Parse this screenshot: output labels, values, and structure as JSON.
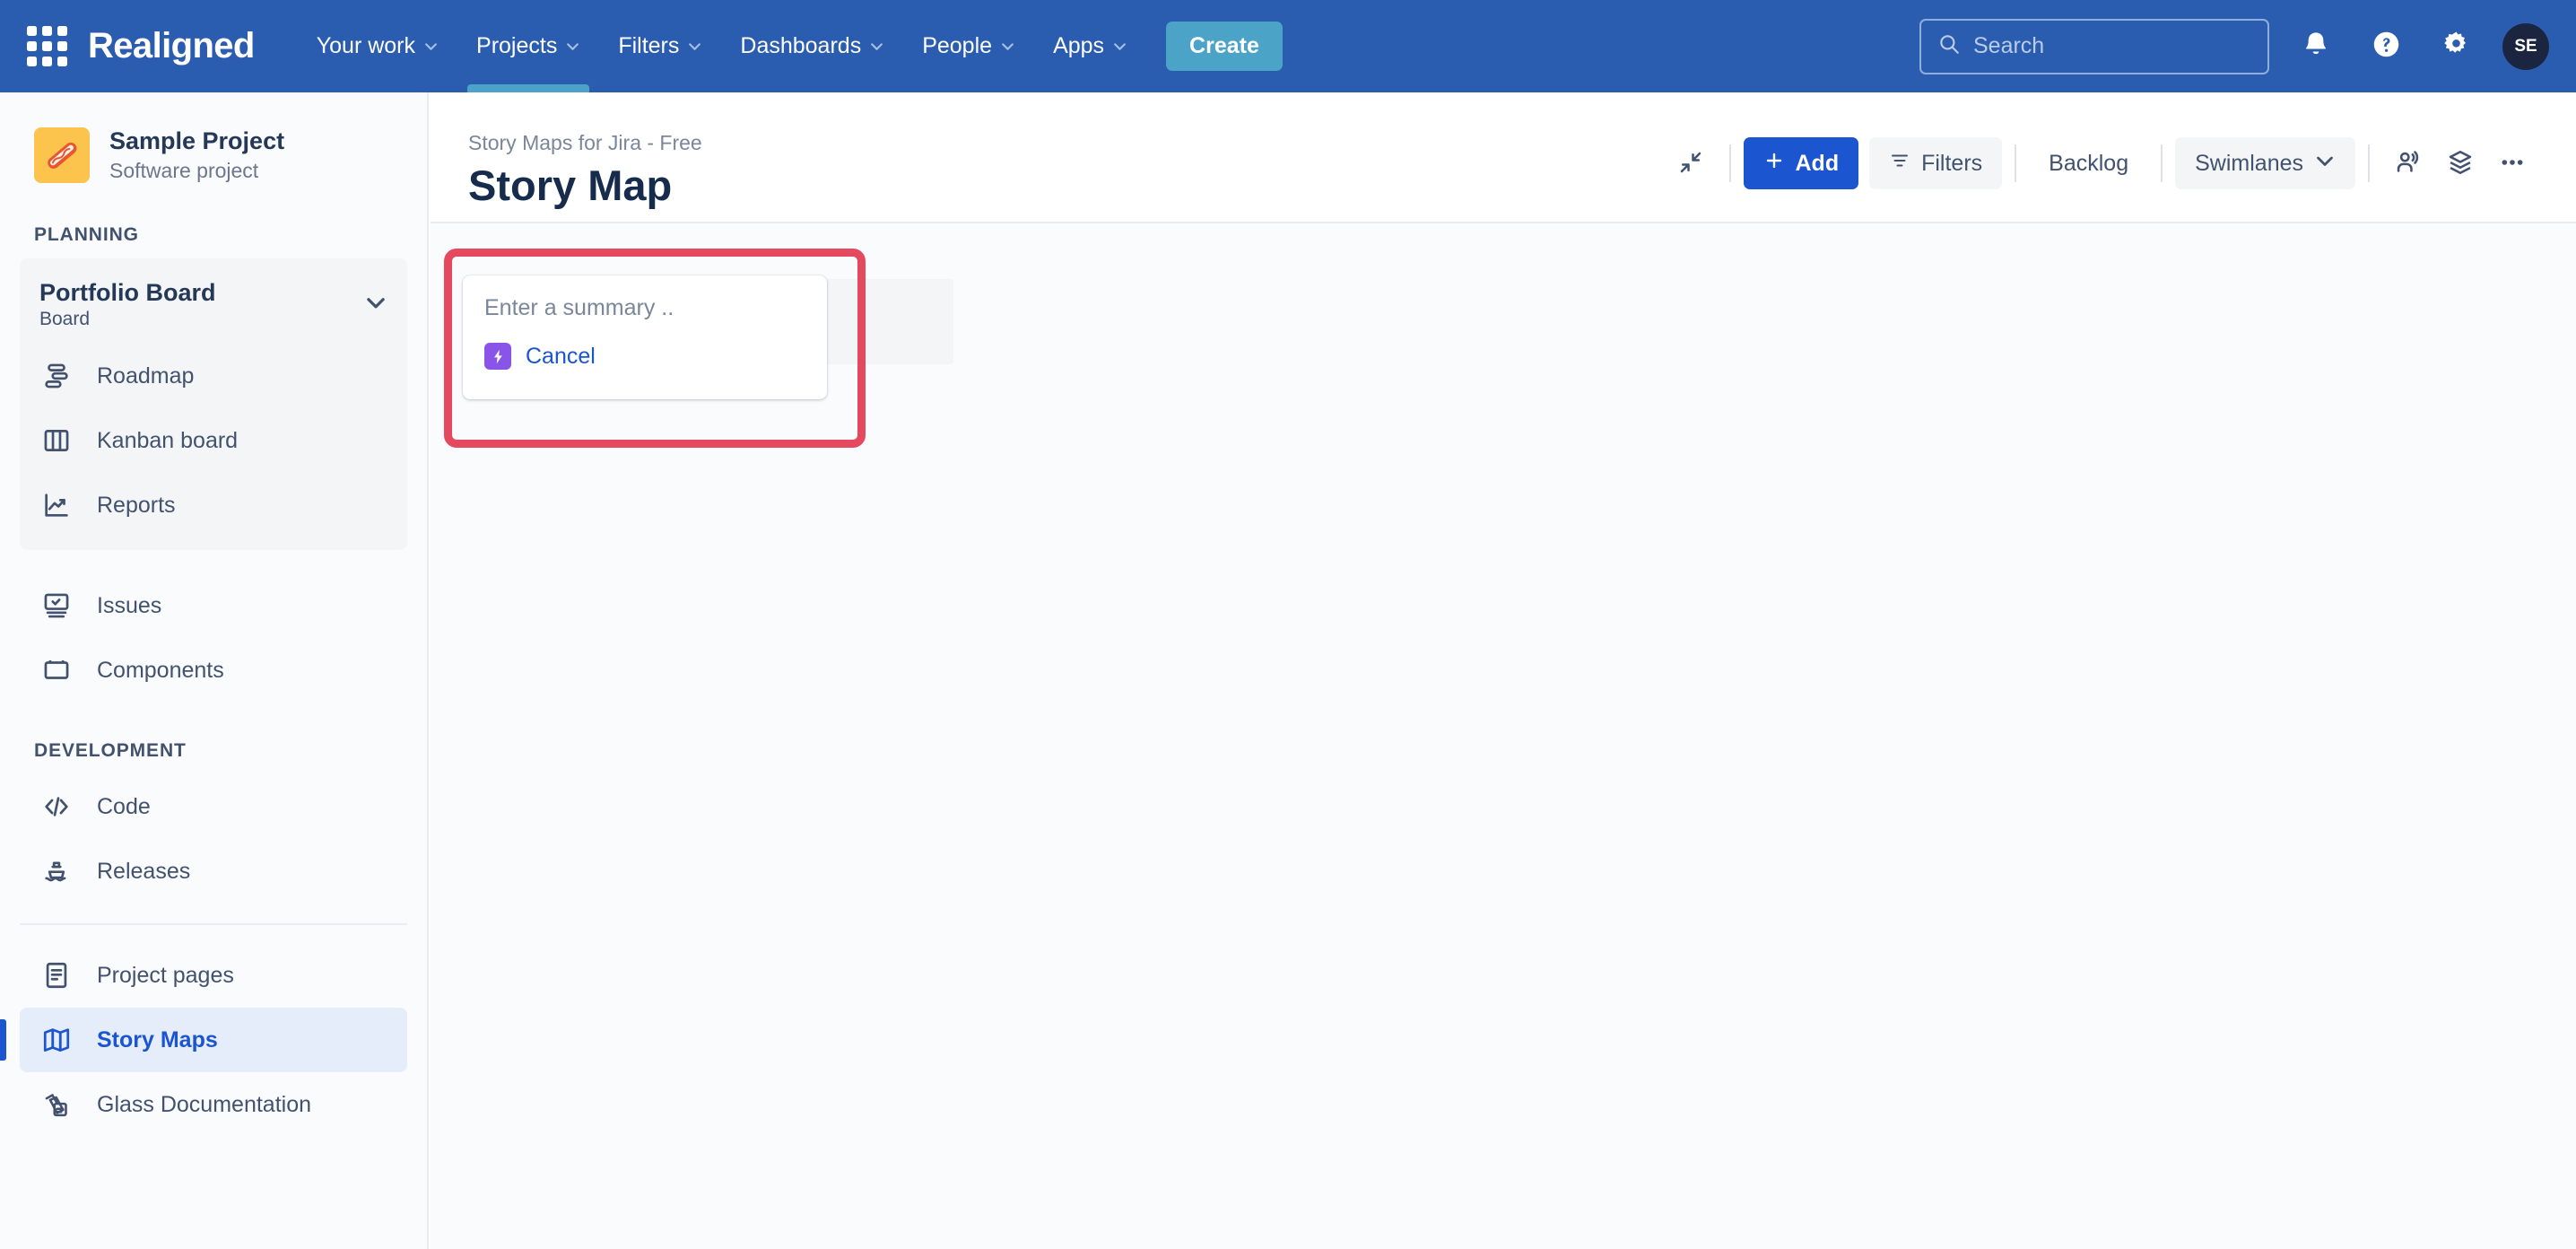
{
  "navbar": {
    "brand": "Realigned",
    "appswitcher_icon": "apps-grid-icon",
    "links": [
      {
        "label": "Your work",
        "has_chevron": true,
        "active": false
      },
      {
        "label": "Projects",
        "has_chevron": true,
        "active": true
      },
      {
        "label": "Filters",
        "has_chevron": true,
        "active": false
      },
      {
        "label": "Dashboards",
        "has_chevron": true,
        "active": false
      },
      {
        "label": "People",
        "has_chevron": true,
        "active": false
      },
      {
        "label": "Apps",
        "has_chevron": true,
        "active": false
      }
    ],
    "create_label": "Create",
    "search_placeholder": "Search",
    "icons": [
      "notifications-bell-icon",
      "help-circle-icon",
      "settings-gear-icon"
    ],
    "avatar_initials": "SE",
    "colors": {
      "background": "#2A5CB0",
      "create_button": "#4BA3C7",
      "active_indicator": "#4BA3C7",
      "avatar": "#1B2540"
    }
  },
  "sidebar": {
    "project_name": "Sample Project",
    "project_type": "Software project",
    "planning_label": "PLANNING",
    "board_group": {
      "title": "Portfolio Board",
      "subtitle": "Board",
      "items": [
        {
          "label": "Roadmap",
          "icon": "roadmap-icon"
        },
        {
          "label": "Kanban board",
          "icon": "board-columns-icon"
        },
        {
          "label": "Reports",
          "icon": "chart-trend-icon"
        }
      ]
    },
    "standalone_items": [
      {
        "label": "Issues",
        "icon": "issues-icon"
      },
      {
        "label": "Components",
        "icon": "components-icon"
      }
    ],
    "development_label": "DEVELOPMENT",
    "development_items": [
      {
        "label": "Code",
        "icon": "code-brackets-icon"
      },
      {
        "label": "Releases",
        "icon": "releases-ship-icon"
      }
    ],
    "footer_items": [
      {
        "label": "Project pages",
        "icon": "page-document-icon",
        "selected": false
      },
      {
        "label": "Story Maps",
        "icon": "map-icon",
        "selected": true
      },
      {
        "label": "Glass Documentation",
        "icon": "glass-docs-icon",
        "selected": false
      }
    ],
    "selected_color": "#1B55D0"
  },
  "page": {
    "breadcrumb": "Story Maps for Jira - Free",
    "title": "Story Map",
    "toolbar": {
      "collapse_icon": "collapse-arrows-icon",
      "add_label": "Add",
      "add_icon": "plus-icon",
      "filters_label": "Filters",
      "filters_icon": "filter-icon",
      "backlog_label": "Backlog",
      "swimlanes_label": "Swimlanes",
      "swimlanes_icon": "chevron-down-icon",
      "share_icon": "people-share-icon",
      "layers_icon": "layers-stack-icon",
      "more_icon": "more-ellipsis-icon"
    }
  },
  "canvas": {
    "highlight_color": "#E4495F",
    "card": {
      "summary_placeholder": "Enter a summary ..",
      "summary_value": "",
      "badge_icon": "lightning-bolt-icon",
      "badge_color": "#8B54E8",
      "cancel_label": "Cancel"
    }
  }
}
